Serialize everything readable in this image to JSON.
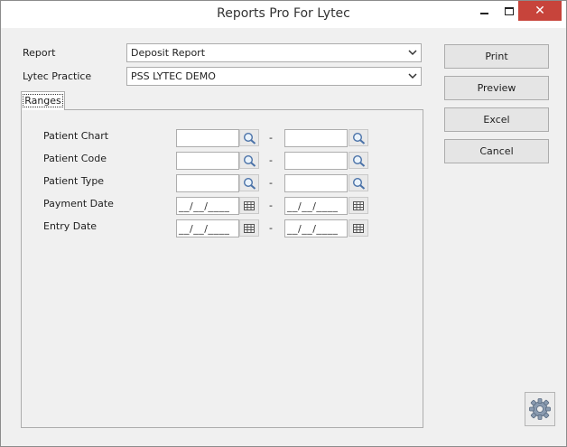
{
  "window": {
    "title": "Reports Pro For Lytec",
    "close_glyph": "✕"
  },
  "form": {
    "report_label": "Report",
    "report_value": "Deposit Report",
    "practice_label": "Lytec Practice",
    "practice_value": "PSS LYTEC DEMO"
  },
  "tabs": [
    {
      "label": "Ranges",
      "active": true
    }
  ],
  "ranges": {
    "separator": "-",
    "patient_chart": {
      "label": "Patient Chart",
      "from": "",
      "to": ""
    },
    "patient_code": {
      "label": "Patient Code",
      "from": "",
      "to": ""
    },
    "patient_type": {
      "label": "Patient Type",
      "from": "",
      "to": ""
    },
    "payment_date": {
      "label": "Payment Date",
      "from": "__/__/____",
      "to": "__/__/____"
    },
    "entry_date": {
      "label": "Entry Date",
      "from": "__/__/____",
      "to": "__/__/____"
    }
  },
  "buttons": {
    "print": "Print",
    "preview": "Preview",
    "excel": "Excel",
    "cancel": "Cancel"
  },
  "icons": {
    "lookup": "magnifier-icon",
    "calendar": "calendar-icon",
    "settings": "gear-icon",
    "dropdown": "chevron-down-icon"
  }
}
